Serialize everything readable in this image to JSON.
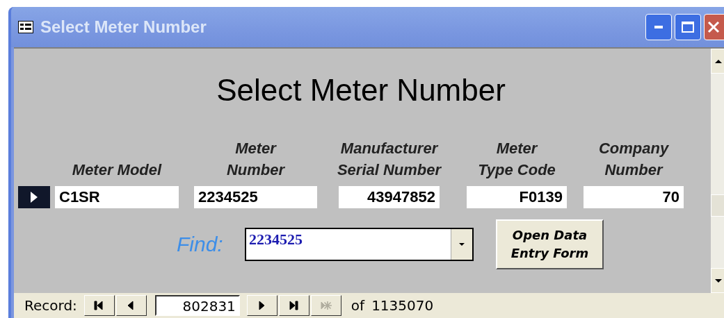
{
  "window": {
    "title": "Select Meter Number"
  },
  "heading": "Select Meter Number",
  "record_selector": {
    "current": true
  },
  "fields": [
    {
      "label": "Meter Model",
      "value": "C1SR",
      "kind": "text"
    },
    {
      "label": "Meter\nNumber",
      "value": "2234525",
      "kind": "text"
    },
    {
      "label": "Manufacturer\nSerial Number",
      "value": "43947852",
      "kind": "numeric"
    },
    {
      "label": "Meter\nType Code",
      "value": "F0139",
      "kind": "numeric"
    },
    {
      "label": "Company\nNumber",
      "value": "70",
      "kind": "numeric"
    }
  ],
  "find": {
    "label": "Find:",
    "value": "2234525"
  },
  "open_button": {
    "label": "Open Data\nEntry Form"
  },
  "navigation": {
    "label": "Record:",
    "record": "802831",
    "of": "of",
    "total": "1135070",
    "buttons": [
      {
        "kind": "first",
        "disabled": false
      },
      {
        "kind": "previous",
        "disabled": false
      },
      {
        "kind": "next",
        "disabled": false
      },
      {
        "kind": "last",
        "disabled": false
      },
      {
        "kind": "new",
        "disabled": true
      }
    ]
  }
}
